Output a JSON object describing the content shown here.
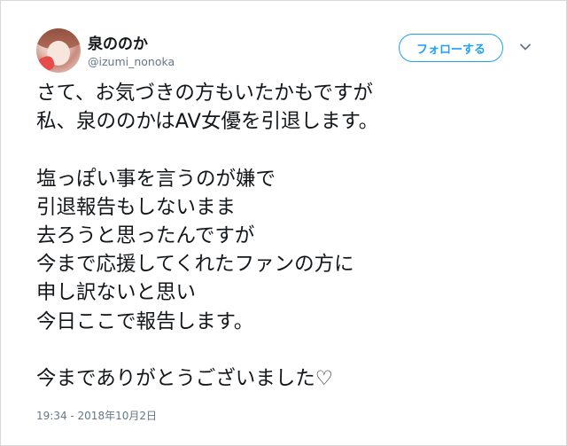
{
  "user": {
    "display_name": "泉ののか",
    "handle": "@izumi_nonoka"
  },
  "actions": {
    "follow_label": "フォローする",
    "menu_icon": "chevron-down-icon"
  },
  "tweet": {
    "text": "さて、お気づきの方もいたかもですが\n私、泉ののかはAV女優を引退します。\n\n塩っぽい事を言うのが嫌で\n引退報告もしないまま\n去ろうと思ったんですが\n今まで応援してくれたファンの方に\n申し訳ないと思い\n今日ここで報告します。\n\n今までありがとうございました♡",
    "timestamp": "19:34 - 2018年10月2日"
  },
  "colors": {
    "accent": "#1da1f2",
    "text": "#14171a",
    "secondary": "#657786",
    "border": "#d8d8d8"
  }
}
